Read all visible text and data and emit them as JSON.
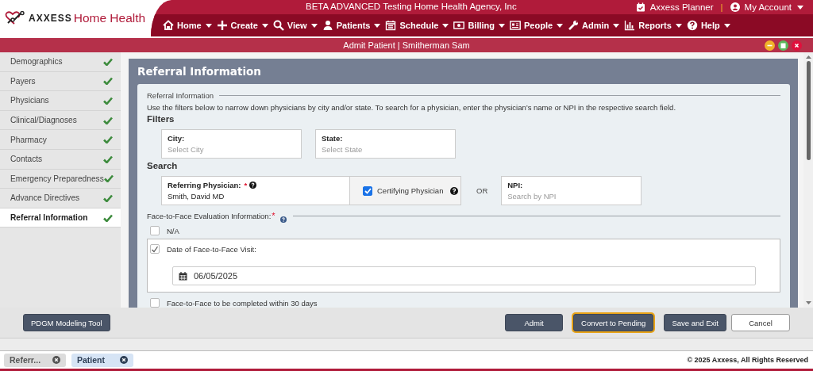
{
  "header": {
    "logo": {
      "brand": "AXXESS",
      "product": "Home Health"
    },
    "agency": "BETA ADVANCED Testing Home Health Agency, Inc",
    "planner": "Axxess Planner",
    "separator": "|",
    "account": "My Account",
    "nav": [
      {
        "label": "Home",
        "kind": "home"
      },
      {
        "label": "Create",
        "kind": "plus"
      },
      {
        "label": "View",
        "kind": "search"
      },
      {
        "label": "Patients",
        "kind": "person"
      },
      {
        "label": "Schedule",
        "kind": "calendar"
      },
      {
        "label": "Billing",
        "kind": "money"
      },
      {
        "label": "People",
        "kind": "card"
      },
      {
        "label": "Admin",
        "kind": "wrench"
      },
      {
        "label": "Reports",
        "kind": "chart"
      },
      {
        "label": "Help",
        "kind": "help"
      }
    ]
  },
  "window": {
    "title": "Admit Patient | Smitherman Sam"
  },
  "sidebar": {
    "items": [
      {
        "label": "Demographics",
        "completed": true,
        "selected": false
      },
      {
        "label": "Payers",
        "completed": true,
        "selected": false
      },
      {
        "label": "Physicians",
        "completed": true,
        "selected": false
      },
      {
        "label": "Clinical/Diagnoses",
        "completed": true,
        "selected": false
      },
      {
        "label": "Pharmacy",
        "completed": true,
        "selected": false
      },
      {
        "label": "Contacts",
        "completed": true,
        "selected": false
      },
      {
        "label": "Emergency Preparedness",
        "completed": true,
        "selected": false
      },
      {
        "label": "Advance Directives",
        "completed": true,
        "selected": false
      },
      {
        "label": "Referral Information",
        "completed": true,
        "selected": true
      }
    ]
  },
  "panel": {
    "title": "Referral Information",
    "legend": "Referral Information",
    "instructions": "Use the filters below to narrow down physicians by city and/or state. To search for a physician, enter the physician’s name or NPI in the respective search field.",
    "filters": {
      "heading": "Filters",
      "fields": [
        {
          "label": "City:",
          "placeholder": "Select City"
        },
        {
          "label": "State:",
          "placeholder": "Select State"
        }
      ]
    },
    "search": {
      "heading": "Search",
      "referring": {
        "label": "Referring Physician:",
        "required_mark": "*",
        "help": true,
        "value": "Smith, David MD"
      },
      "certifying": {
        "label": "Certifying Physician",
        "checked": true,
        "help": true
      },
      "or": "OR",
      "npi": {
        "label": "NPI:",
        "placeholder": "Search by NPI"
      }
    },
    "face_to_face": {
      "label": "Face-to-Face Evaluation Information:",
      "required_mark": "*",
      "help": true,
      "options": [
        {
          "kind": "plain",
          "label": "N/A",
          "checked": false
        },
        {
          "kind": "date",
          "label": "Date of Face-to-Face Visit:",
          "checked": true,
          "date": "06/05/2025"
        },
        {
          "kind": "plain",
          "label": "Face-to-Face to be completed within 30 days",
          "checked": false
        }
      ]
    }
  },
  "footer": {
    "buttons": [
      {
        "label": "PDGM Modeling Tool",
        "kind": "tool",
        "focused": false
      },
      {
        "label": "Admit",
        "kind": "dark",
        "focused": false
      },
      {
        "label": "Convert to Pending",
        "kind": "dark",
        "focused": true
      },
      {
        "label": "Save and Exit",
        "kind": "dark",
        "focused": false
      },
      {
        "label": "Cancel",
        "kind": "light",
        "focused": false
      }
    ]
  },
  "tabs": [
    {
      "label": "Referr...",
      "selected": false
    },
    {
      "label": "Patient",
      "selected": true
    }
  ],
  "copyright": "© 2025 Axxess, All Rights Reserved"
}
